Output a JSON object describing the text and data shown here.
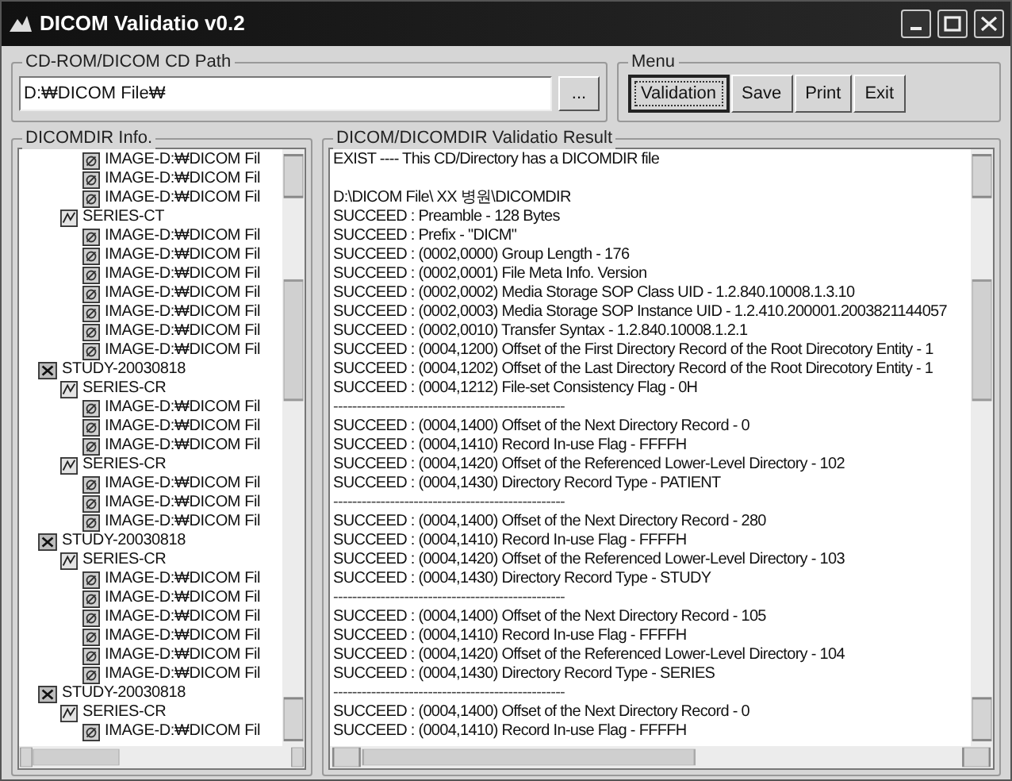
{
  "window": {
    "title": "DICOM Validatio v0.2"
  },
  "path_group": {
    "label": "CD-ROM/DICOM CD Path",
    "path": {
      "value": "D:₩DICOM File₩"
    },
    "browse_button": "..."
  },
  "menu": {
    "label": "Menu",
    "buttons": [
      {
        "label": "Validation",
        "default": true
      },
      {
        "label": "Save",
        "default": false
      },
      {
        "label": "Print",
        "default": false
      },
      {
        "label": "Exit",
        "default": false
      }
    ]
  },
  "dicomdir_info": {
    "label": "DICOMDIR Info.",
    "tree": [
      {
        "kind": "image",
        "label": "IMAGE-D:₩DICOM Fil"
      },
      {
        "kind": "image",
        "label": "IMAGE-D:₩DICOM Fil"
      },
      {
        "kind": "image",
        "label": "IMAGE-D:₩DICOM Fil"
      },
      {
        "kind": "series",
        "label": "SERIES-CT",
        "children": [
          {
            "kind": "image",
            "label": "IMAGE-D:₩DICOM Fil"
          },
          {
            "kind": "image",
            "label": "IMAGE-D:₩DICOM Fil"
          },
          {
            "kind": "image",
            "label": "IMAGE-D:₩DICOM Fil"
          },
          {
            "kind": "image",
            "label": "IMAGE-D:₩DICOM Fil"
          },
          {
            "kind": "image",
            "label": "IMAGE-D:₩DICOM Fil"
          },
          {
            "kind": "image",
            "label": "IMAGE-D:₩DICOM Fil"
          },
          {
            "kind": "image",
            "label": "IMAGE-D:₩DICOM Fil"
          }
        ]
      },
      {
        "kind": "study",
        "label": "STUDY-20030818",
        "children": [
          {
            "kind": "series",
            "label": "SERIES-CR",
            "children": [
              {
                "kind": "image",
                "label": "IMAGE-D:₩DICOM Fil"
              },
              {
                "kind": "image",
                "label": "IMAGE-D:₩DICOM Fil"
              },
              {
                "kind": "image",
                "label": "IMAGE-D:₩DICOM Fil"
              }
            ]
          },
          {
            "kind": "series",
            "label": "SERIES-CR",
            "children": [
              {
                "kind": "image",
                "label": "IMAGE-D:₩DICOM Fil"
              },
              {
                "kind": "image",
                "label": "IMAGE-D:₩DICOM Fil"
              },
              {
                "kind": "image",
                "label": "IMAGE-D:₩DICOM Fil"
              }
            ]
          }
        ]
      },
      {
        "kind": "study",
        "label": "STUDY-20030818",
        "children": [
          {
            "kind": "series",
            "label": "SERIES-CR",
            "children": [
              {
                "kind": "image",
                "label": "IMAGE-D:₩DICOM Fil"
              },
              {
                "kind": "image",
                "label": "IMAGE-D:₩DICOM Fil"
              },
              {
                "kind": "image",
                "label": "IMAGE-D:₩DICOM Fil"
              },
              {
                "kind": "image",
                "label": "IMAGE-D:₩DICOM Fil"
              },
              {
                "kind": "image",
                "label": "IMAGE-D:₩DICOM Fil"
              },
              {
                "kind": "image",
                "label": "IMAGE-D:₩DICOM Fil"
              }
            ]
          }
        ]
      },
      {
        "kind": "study",
        "label": "STUDY-20030818",
        "children": [
          {
            "kind": "series",
            "label": "SERIES-CR",
            "children": [
              {
                "kind": "image",
                "label": "IMAGE-D:₩DICOM Fil"
              }
            ]
          }
        ]
      }
    ]
  },
  "result": {
    "label": "DICOM/DICOMDIR Validatio Result",
    "lines": [
      {
        "kind": "text",
        "text": "EXIST  ----  This CD/Directory has a DICOMDIR file"
      },
      {
        "kind": "blank"
      },
      {
        "kind": "text",
        "text": "D:\\DICOM File\\ XX 병원\\DICOMDIR"
      },
      {
        "kind": "text",
        "text": "SUCCEED : Preamble - 128 Bytes"
      },
      {
        "kind": "text",
        "text": "SUCCEED : Prefix - \"DICM\""
      },
      {
        "kind": "text",
        "text": "SUCCEED : (0002,0000) Group Length - 176"
      },
      {
        "kind": "text",
        "text": "SUCCEED : (0002,0001) File Meta Info. Version"
      },
      {
        "kind": "text",
        "text": "SUCCEED : (0002,0002) Media Storage SOP Class UID - 1.2.840.10008.1.3.10"
      },
      {
        "kind": "text",
        "text": "SUCCEED : (0002,0003) Media Storage SOP Instance UID - 1.2.410.200001.2003821144057"
      },
      {
        "kind": "text",
        "text": "SUCCEED : (0002,0010) Transfer Syntax - 1.2.840.10008.1.2.1"
      },
      {
        "kind": "text",
        "text": "SUCCEED : (0004,1200) Offset of the First Directory Record of the Root Direcotory Entity - 1"
      },
      {
        "kind": "text",
        "text": "SUCCEED : (0004,1202) Offset of the Last Directory Record of the Root Direcotory Entity - 1"
      },
      {
        "kind": "text",
        "text": "SUCCEED : (0004,1212) File-set Consistency Flag - 0H"
      },
      {
        "kind": "rule",
        "text": "-------------------------------------------------"
      },
      {
        "kind": "text",
        "text": "SUCCEED : (0004,1400) Offset of the Next Directory Record - 0"
      },
      {
        "kind": "text",
        "text": "SUCCEED : (0004,1410) Record In-use Flag - FFFFH"
      },
      {
        "kind": "text",
        "text": "SUCCEED : (0004,1420) Offset of the Referenced Lower-Level Directory - 102"
      },
      {
        "kind": "text",
        "text": "SUCCEED : (0004,1430) Directory Record Type - PATIENT"
      },
      {
        "kind": "rule",
        "text": "-------------------------------------------------"
      },
      {
        "kind": "text",
        "text": "SUCCEED : (0004,1400) Offset of the Next Directory Record - 280"
      },
      {
        "kind": "text",
        "text": "SUCCEED : (0004,1410) Record In-use Flag - FFFFH"
      },
      {
        "kind": "text",
        "text": "SUCCEED : (0004,1420) Offset of the Referenced Lower-Level Directory - 103"
      },
      {
        "kind": "text",
        "text": "SUCCEED : (0004,1430) Directory Record Type - STUDY"
      },
      {
        "kind": "rule",
        "text": "-------------------------------------------------"
      },
      {
        "kind": "text",
        "text": "SUCCEED : (0004,1400) Offset of the Next Directory Record - 105"
      },
      {
        "kind": "text",
        "text": "SUCCEED : (0004,1410) Record In-use Flag - FFFFH"
      },
      {
        "kind": "text",
        "text": "SUCCEED : (0004,1420) Offset of the Referenced Lower-Level Directory - 104"
      },
      {
        "kind": "text",
        "text": "SUCCEED : (0004,1430) Directory Record Type - SERIES"
      },
      {
        "kind": "rule",
        "text": "-------------------------------------------------"
      },
      {
        "kind": "text",
        "text": "SUCCEED : (0004,1400) Offset of the Next Directory Record - 0"
      },
      {
        "kind": "text",
        "text": "SUCCEED : (0004,1410) Record In-use Flag - FFFFH"
      }
    ]
  }
}
